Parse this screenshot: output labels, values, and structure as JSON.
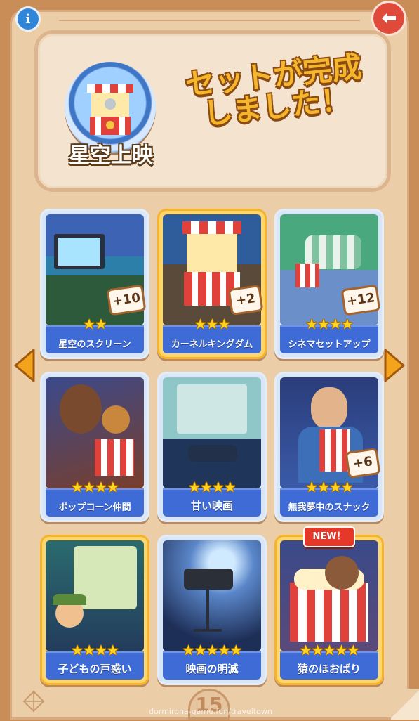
{
  "header": {
    "info_icon": "info-icon",
    "back_icon": "back-arrow-icon"
  },
  "banner": {
    "set_name": "星空上映",
    "complete_message": "セットが完成しました！"
  },
  "cards": [
    {
      "title": "星空のスクリーン",
      "stars": "★★",
      "bonus": "+10",
      "gold": false
    },
    {
      "title": "カーネルキングダム",
      "stars": "★★★",
      "bonus": "+2",
      "gold": true
    },
    {
      "title": "シネマセットアップ",
      "stars": "★★★★",
      "bonus": "+12",
      "gold": false
    },
    {
      "title": "ポップコーン仲間",
      "stars": "★★★★",
      "bonus": "",
      "gold": false
    },
    {
      "title": "甘い映画",
      "stars": "★★★★",
      "bonus": "",
      "gold": false
    },
    {
      "title": "無我夢中のスナック",
      "stars": "★★★★",
      "bonus": "+6",
      "gold": false
    },
    {
      "title": "子どもの戸惑い",
      "stars": "★★★★",
      "bonus": "",
      "gold": true
    },
    {
      "title": "映画の明滅",
      "stars": "★★★★★",
      "bonus": "",
      "gold": false
    },
    {
      "title": "猿のほおばり",
      "stars": "★★★★★",
      "bonus": "",
      "gold": true
    }
  ],
  "new_badge": "NEW！",
  "page_number": "15",
  "watermark": "dormirona-game.fun/traveltown",
  "colors": {
    "label_bar": "#3e6bd6",
    "book": "#ebcda8",
    "accent_text": "#f4b62a"
  }
}
